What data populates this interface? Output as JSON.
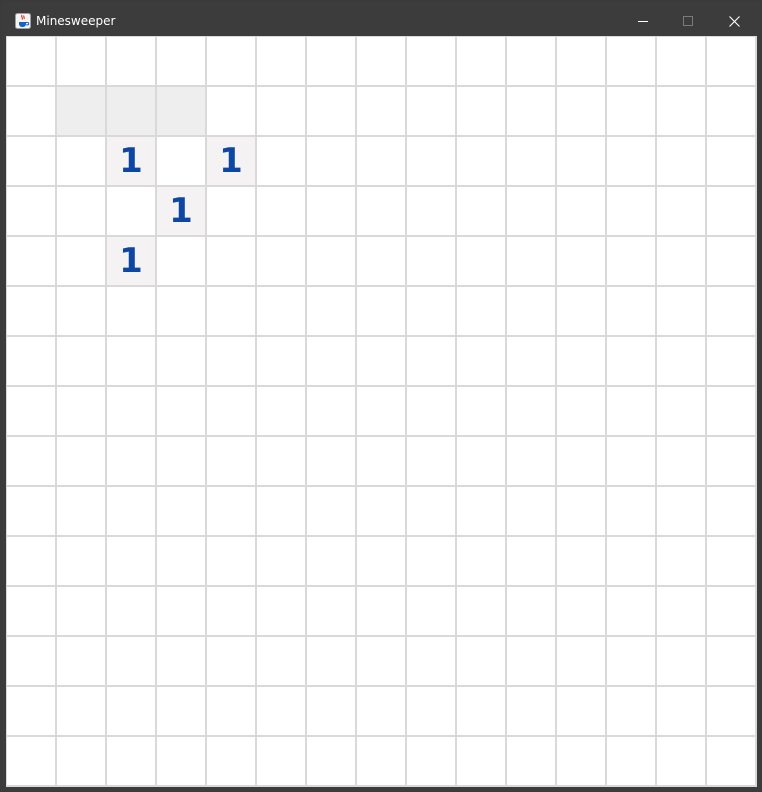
{
  "window": {
    "title": "Minesweeper",
    "app_icon": "java-cup-icon",
    "controls": [
      "minimize-icon",
      "maximize-icon",
      "close-icon"
    ]
  },
  "board": {
    "rows": 15,
    "cols": 15,
    "revealed_cells": [
      {
        "row": 1,
        "col": 1,
        "label": ""
      },
      {
        "row": 1,
        "col": 2,
        "label": ""
      },
      {
        "row": 1,
        "col": 3,
        "label": ""
      },
      {
        "row": 2,
        "col": 2,
        "label": "1"
      },
      {
        "row": 2,
        "col": 4,
        "label": "1"
      },
      {
        "row": 3,
        "col": 3,
        "label": "1"
      },
      {
        "row": 4,
        "col": 2,
        "label": "1"
      }
    ],
    "number_color": "#0d47a1",
    "hidden_color": "#ffffff",
    "revealed_color": "#eeeeee",
    "numbered_color": "#f4f2f2"
  }
}
